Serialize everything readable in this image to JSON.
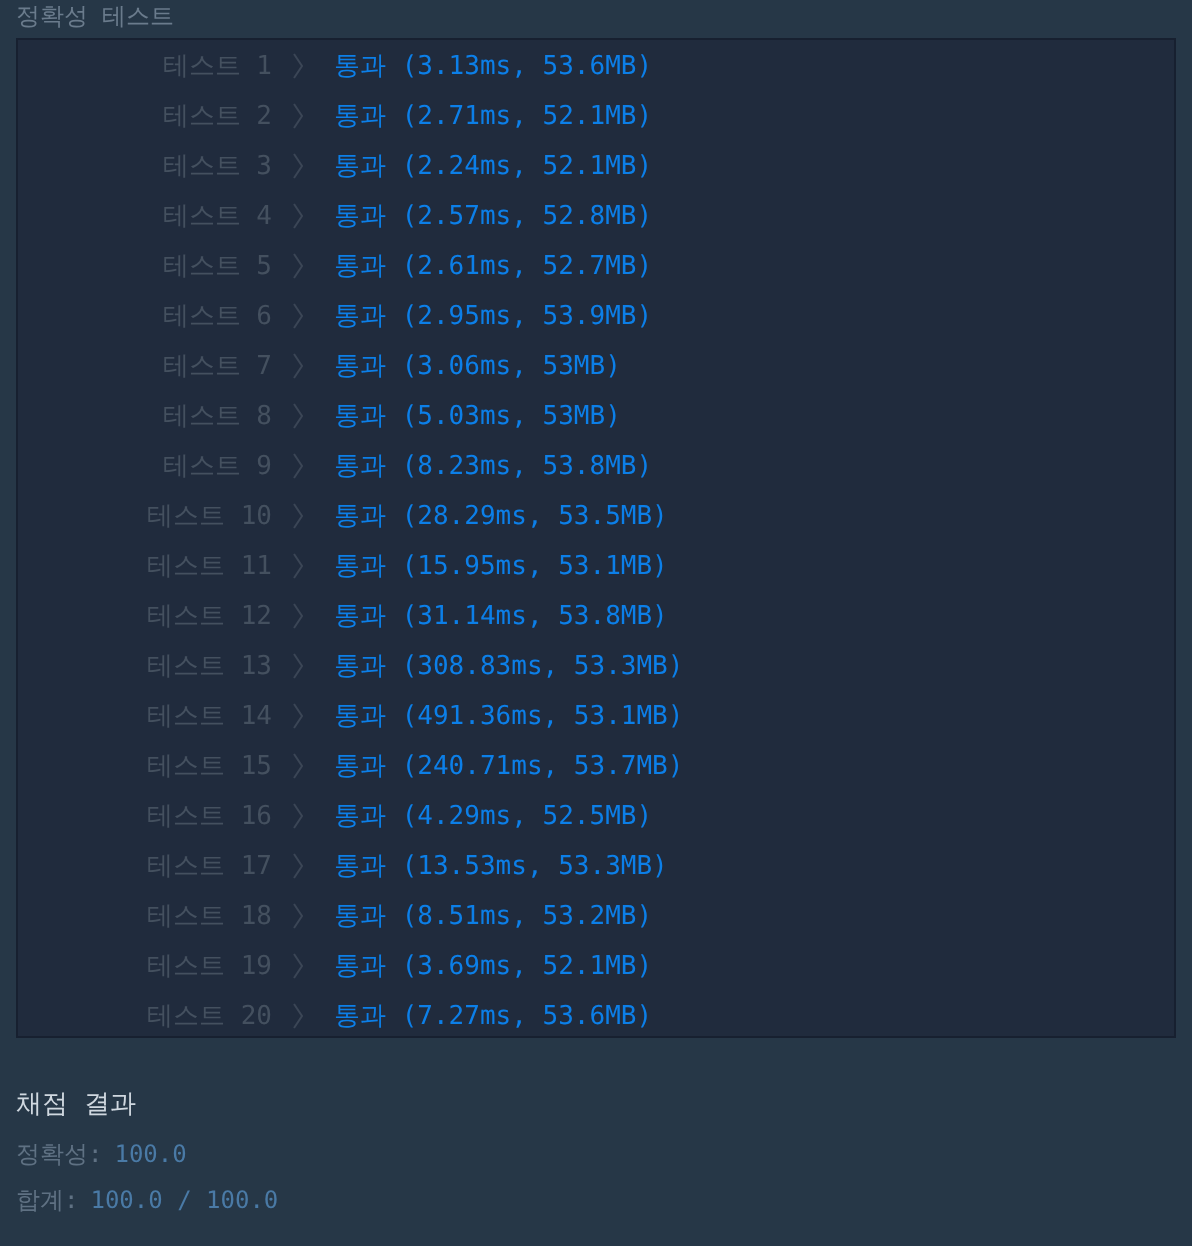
{
  "header": {
    "title": "정확성  테스트"
  },
  "tests": [
    {
      "label": "테스트 1",
      "result": "통과 (3.13ms, 53.6MB)"
    },
    {
      "label": "테스트 2",
      "result": "통과 (2.71ms, 52.1MB)"
    },
    {
      "label": "테스트 3",
      "result": "통과 (2.24ms, 52.1MB)"
    },
    {
      "label": "테스트 4",
      "result": "통과 (2.57ms, 52.8MB)"
    },
    {
      "label": "테스트 5",
      "result": "통과 (2.61ms, 52.7MB)"
    },
    {
      "label": "테스트 6",
      "result": "통과 (2.95ms, 53.9MB)"
    },
    {
      "label": "테스트 7",
      "result": "통과 (3.06ms, 53MB)"
    },
    {
      "label": "테스트 8",
      "result": "통과 (5.03ms, 53MB)"
    },
    {
      "label": "테스트 9",
      "result": "통과 (8.23ms, 53.8MB)"
    },
    {
      "label": "테스트 10",
      "result": "통과 (28.29ms, 53.5MB)"
    },
    {
      "label": "테스트 11",
      "result": "통과 (15.95ms, 53.1MB)"
    },
    {
      "label": "테스트 12",
      "result": "통과 (31.14ms, 53.8MB)"
    },
    {
      "label": "테스트 13",
      "result": "통과 (308.83ms, 53.3MB)"
    },
    {
      "label": "테스트 14",
      "result": "통과 (491.36ms, 53.1MB)"
    },
    {
      "label": "테스트 15",
      "result": "통과 (240.71ms, 53.7MB)"
    },
    {
      "label": "테스트 16",
      "result": "통과 (4.29ms, 52.5MB)"
    },
    {
      "label": "테스트 17",
      "result": "통과 (13.53ms, 53.3MB)"
    },
    {
      "label": "테스트 18",
      "result": "통과 (8.51ms, 53.2MB)"
    },
    {
      "label": "테스트 19",
      "result": "통과 (3.69ms, 52.1MB)"
    },
    {
      "label": "테스트 20",
      "result": "통과 (7.27ms, 53.6MB)"
    }
  ],
  "summary": {
    "title": "채점 결과",
    "lines": [
      {
        "label": "정확성:",
        "value": "100.0"
      },
      {
        "label": "합계:",
        "value": "100.0 / 100.0"
      }
    ]
  }
}
